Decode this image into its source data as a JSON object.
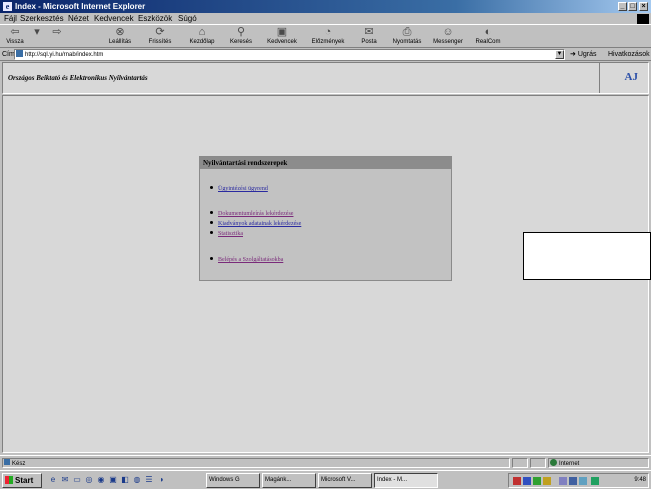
{
  "window": {
    "title": "Index - Microsoft Internet Explorer"
  },
  "menubar": {
    "items": [
      "Fájl",
      "Szerkesztés",
      "Nézet",
      "Kedvencek",
      "Eszközök",
      "Súgó"
    ]
  },
  "toolbar": {
    "buttons": [
      "Vissza",
      "",
      "Leállítás",
      "Frissítés",
      "Kezdőlap",
      "Keresés",
      "Kedvencek",
      "Előzmények",
      "Posta",
      "Nyomtatás",
      "Messenger",
      "RealCom"
    ]
  },
  "addressbar": {
    "label": "Cím",
    "url": "http://sql.yi.hu/rnab/index.htm",
    "go_label": "Ugrás",
    "links_label": "Hivatkozások"
  },
  "header": {
    "title": "Országos Beiktató és Elektronikus Nyilvántartás",
    "logo_text": "AJ"
  },
  "menu_panel": {
    "heading": "Nyilvántartási rendszerepek",
    "items": [
      {
        "label": "Ügyintézési ügyrend"
      },
      {
        "label": "Dokumentumleírás lekérdezése"
      },
      {
        "label": "Kiadványok adatainak lekérdezése"
      },
      {
        "label": "Statisztika"
      },
      {
        "label": "Belépés a Szolgáltatásokba"
      }
    ]
  },
  "statusbar": {
    "text": "Kész",
    "zone": "Internet"
  },
  "taskbar": {
    "start_label": "Start",
    "tasks": [
      "Windows G",
      "Magánk...",
      "Microsoft V...",
      "Index - M..."
    ],
    "clock": "9:48"
  },
  "colors": {
    "titlebar": "#0a246a",
    "link": "#2a2aa0",
    "visited_link": "#7a2a7a",
    "panel_header": "#8c8c8c"
  }
}
